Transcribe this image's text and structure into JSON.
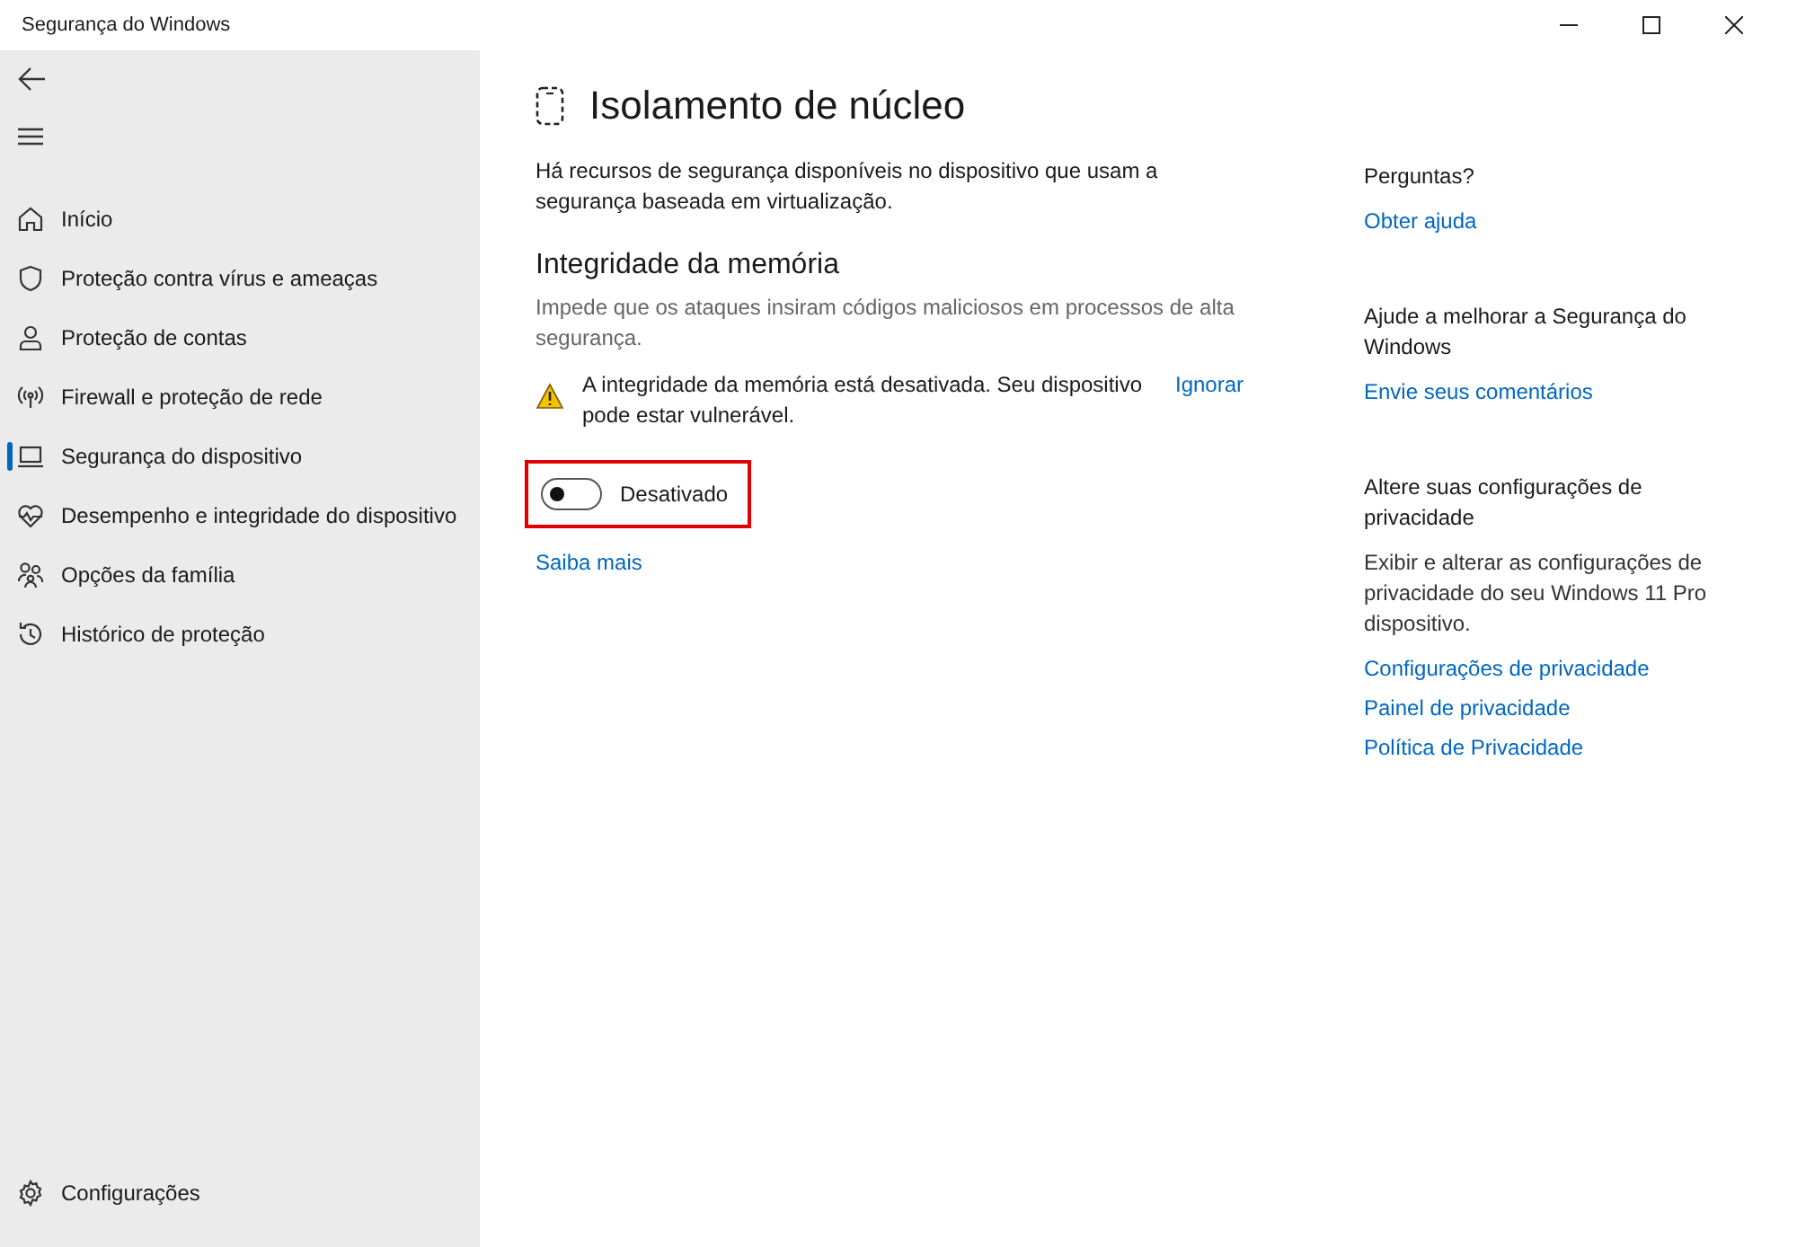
{
  "window": {
    "title": "Segurança do Windows"
  },
  "sidebar": {
    "items": [
      {
        "label": "Início",
        "selected": false
      },
      {
        "label": "Proteção contra vírus e ameaças",
        "selected": false
      },
      {
        "label": "Proteção de contas",
        "selected": false
      },
      {
        "label": "Firewall e proteção de rede",
        "selected": false
      },
      {
        "label": "Segurança do dispositivo",
        "selected": true
      },
      {
        "label": "Desempenho e integridade do dispositivo",
        "selected": false
      },
      {
        "label": "Opções da família",
        "selected": false
      },
      {
        "label": "Histórico de proteção",
        "selected": false
      }
    ],
    "settings": {
      "label": "Configurações"
    }
  },
  "page": {
    "title": "Isolamento de núcleo",
    "description": "Há recursos de segurança disponíveis no dispositivo que usam a segurança baseada em virtualização.",
    "section": {
      "title": "Integridade da memória",
      "description": "Impede que os ataques insiram códigos maliciosos em processos de alta segurança.",
      "warning": {
        "text": "A integridade da memória está desativada. Seu dispositivo pode estar vulnerável.",
        "action": "Ignorar"
      },
      "toggle": {
        "on": false,
        "label": "Desativado",
        "highlighted": true
      },
      "link": "Saiba mais"
    }
  },
  "aside": [
    {
      "title": "Perguntas?",
      "links": [
        "Obter ajuda"
      ]
    },
    {
      "title": "Ajude a melhorar a Segurança do Windows",
      "links": [
        "Envie seus comentários"
      ]
    },
    {
      "title": "Altere suas configurações de privacidade",
      "text": "Exibir e alterar as configurações de privacidade do seu Windows 11 Pro dispositivo.",
      "links": [
        "Configurações de privacidade",
        "Painel de privacidade",
        "Política de Privacidade"
      ]
    }
  ]
}
